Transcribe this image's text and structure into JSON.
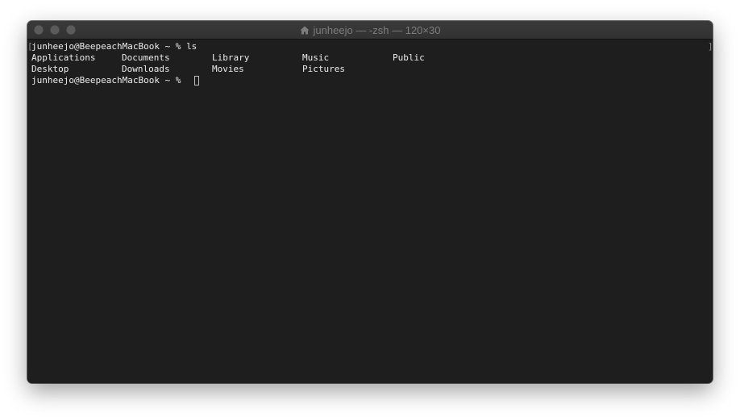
{
  "window": {
    "title": "junheejo — -zsh — 120×30",
    "title_icon": "home-icon",
    "traffic_lights": [
      "close",
      "minimize",
      "zoom"
    ]
  },
  "terminal": {
    "lines": [
      {
        "prompt": "junheejo@BeepeachMacBook ~ %",
        "command": "ls"
      }
    ],
    "ls_output": [
      [
        "Applications",
        "Documents",
        "Library",
        "Music",
        "Public"
      ],
      [
        "Desktop",
        "Downloads",
        "Movies",
        "Pictures"
      ]
    ],
    "current_prompt": "junheejo@BeepeachMacBook ~ %",
    "colors": {
      "background": "#1e1e1e",
      "foreground": "#ececec"
    }
  }
}
